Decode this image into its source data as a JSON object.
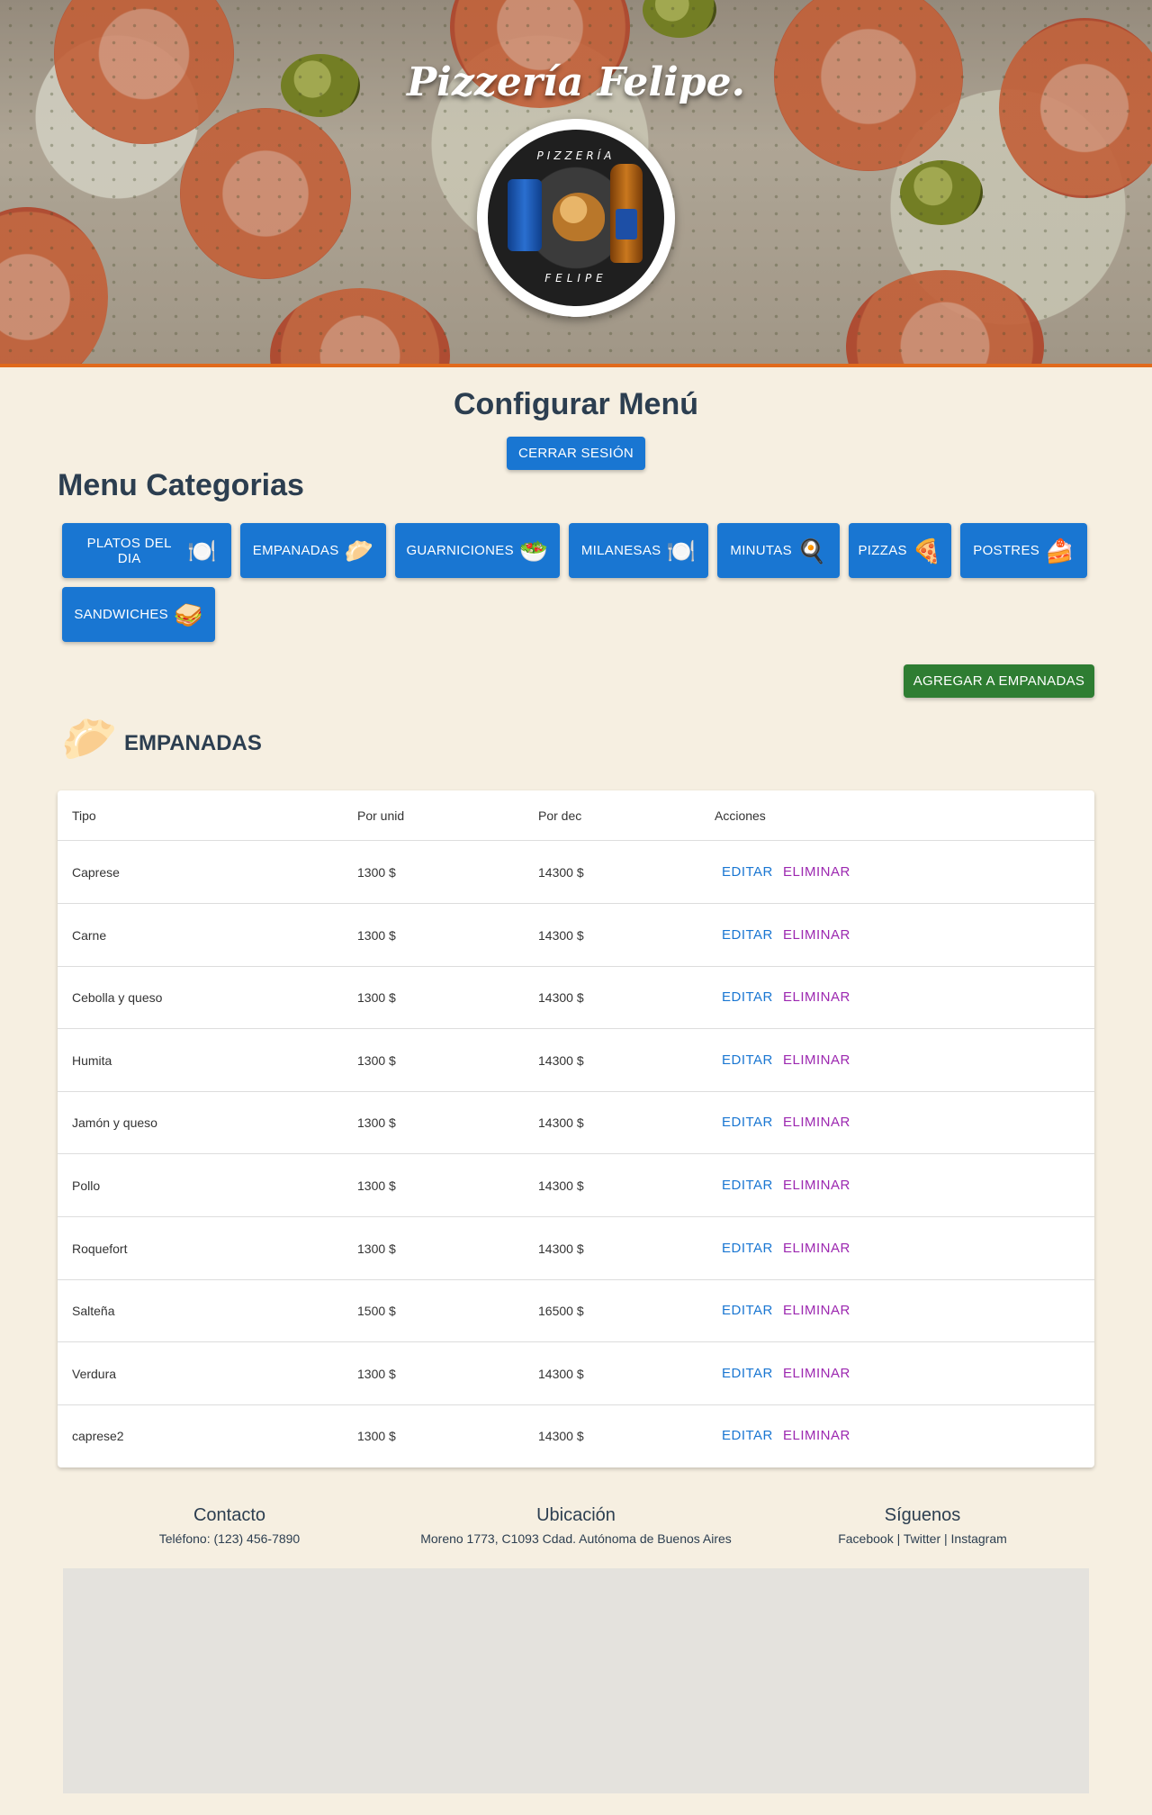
{
  "brand": {
    "title": "Pizzería Felipe.",
    "logo_top_text": "PIZZERÍA",
    "logo_bottom_text": "FELIPE",
    "accent_color": "#e06a1c"
  },
  "page": {
    "title": "Configurar Menú",
    "logout_label": "CERRAR SESIÓN",
    "categories_heading": "Menu Categorias"
  },
  "categories": [
    {
      "label": "PLATOS DEL DIA",
      "icon": "🍽️",
      "icon_name": "plate-cutlery-icon"
    },
    {
      "label": "EMPANADAS",
      "icon": "🥟",
      "icon_name": "empanada-icon"
    },
    {
      "label": "GUARNICIONES",
      "icon": "🥗",
      "icon_name": "salad-icon"
    },
    {
      "label": "MILANESAS",
      "icon": "🍽️",
      "icon_name": "plate-cutlery-icon"
    },
    {
      "label": "MINUTAS",
      "icon": "🍳",
      "icon_name": "frying-pan-icon"
    },
    {
      "label": "PIZZAS",
      "icon": "🍕",
      "icon_name": "pizza-icon"
    },
    {
      "label": "POSTRES",
      "icon": "🍰",
      "icon_name": "cake-icon"
    },
    {
      "label": "SANDWICHES",
      "icon": "🥪",
      "icon_name": "sandwich-icon"
    }
  ],
  "add_button_label": "AGREGAR A EMPANADAS",
  "section": {
    "icon": "🥟",
    "icon_name": "empanada-icon",
    "title": "EMPANADAS"
  },
  "table": {
    "headers": [
      "Tipo",
      "Por unid",
      "Por dec",
      "Acciones"
    ],
    "edit_label": "EDITAR",
    "delete_label": "ELIMINAR",
    "rows": [
      {
        "tipo": "Caprese",
        "unid": "1300 $",
        "dec": "14300 $"
      },
      {
        "tipo": "Carne",
        "unid": "1300 $",
        "dec": "14300 $"
      },
      {
        "tipo": "Cebolla y queso",
        "unid": "1300 $",
        "dec": "14300 $"
      },
      {
        "tipo": "Humita",
        "unid": "1300 $",
        "dec": "14300 $"
      },
      {
        "tipo": "Jamón y queso",
        "unid": "1300 $",
        "dec": "14300 $"
      },
      {
        "tipo": "Pollo",
        "unid": "1300 $",
        "dec": "14300 $"
      },
      {
        "tipo": "Roquefort",
        "unid": "1300 $",
        "dec": "14300 $"
      },
      {
        "tipo": "Salteña",
        "unid": "1500 $",
        "dec": "16500 $"
      },
      {
        "tipo": "Verdura",
        "unid": "1300 $",
        "dec": "14300 $"
      },
      {
        "tipo": "caprese2",
        "unid": "1300 $",
        "dec": "14300 $"
      }
    ]
  },
  "footer": {
    "contact": {
      "title": "Contacto",
      "text": "Teléfono: (123) 456-7890"
    },
    "location": {
      "title": "Ubicación",
      "text": "Moreno 1773, C1093 Cdad. Autónoma de Buenos Aires"
    },
    "social": {
      "title": "Síguenos",
      "links": [
        "Facebook",
        "Twitter",
        "Instagram"
      ],
      "separator": " | "
    }
  },
  "colors": {
    "primary_button": "#1976d2",
    "add_button": "#2e7d32",
    "edit_action": "#1976d2",
    "delete_action": "#9c27b0",
    "page_background": "#f6efe1"
  }
}
